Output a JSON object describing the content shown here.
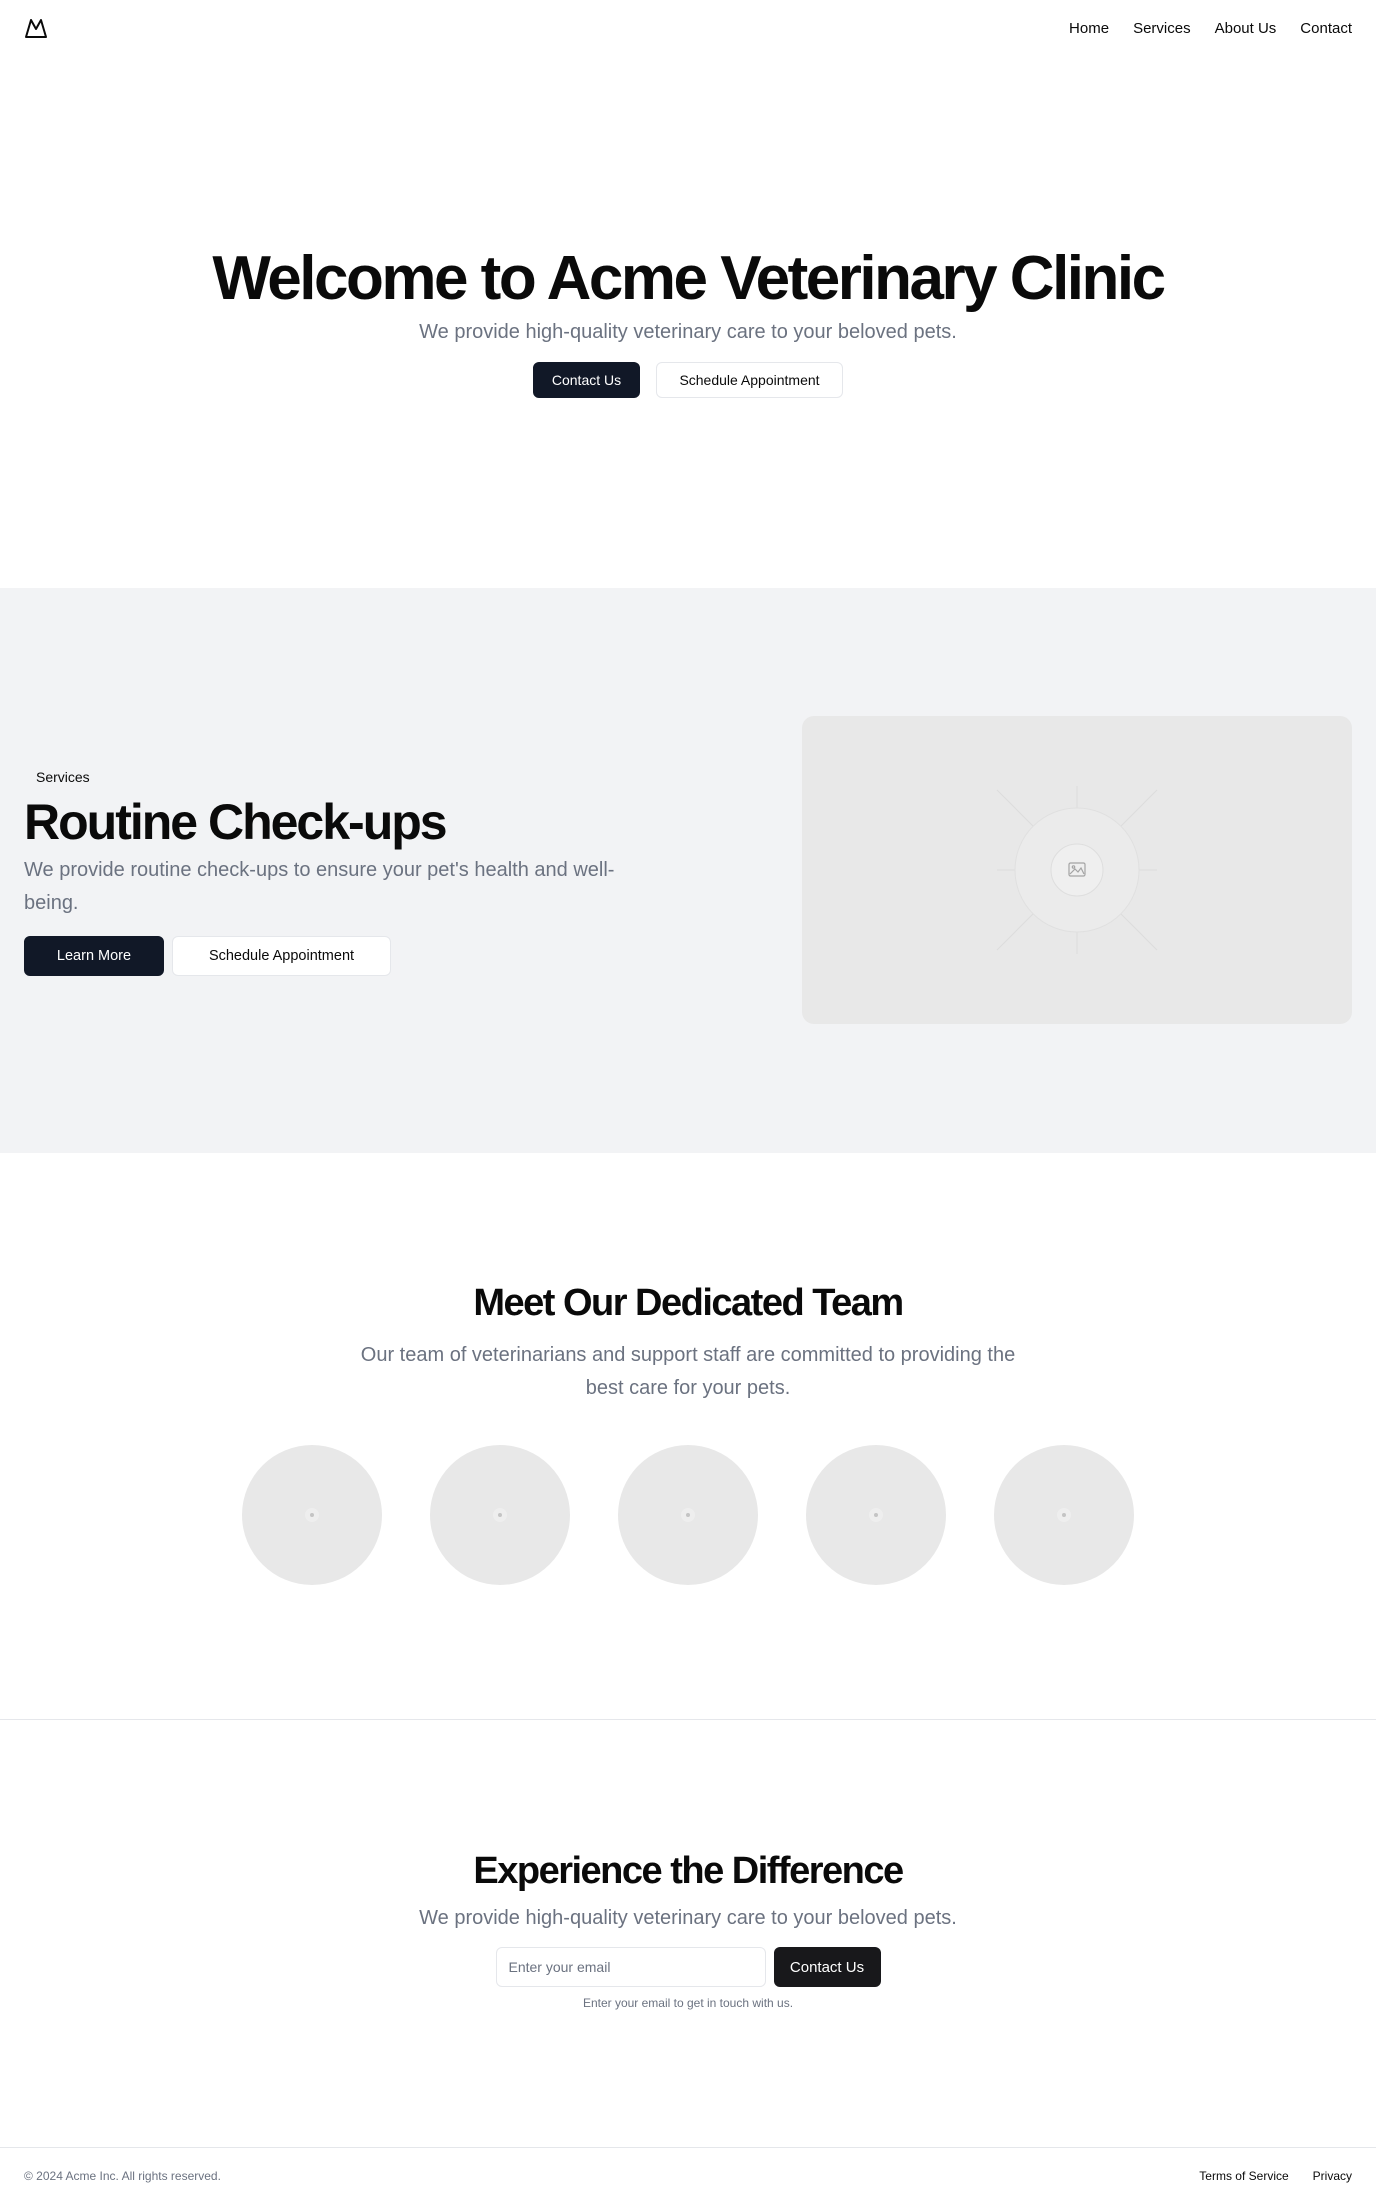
{
  "header": {
    "logo_icon": "mountain-icon",
    "nav": [
      {
        "label": "Home"
      },
      {
        "label": "Services"
      },
      {
        "label": "About Us"
      },
      {
        "label": "Contact"
      }
    ]
  },
  "hero": {
    "title": "Welcome to Acme Veterinary Clinic",
    "subtitle": "We provide high-quality veterinary care to your beloved pets.",
    "primary_button": "Contact Us",
    "secondary_button": "Schedule Appointment"
  },
  "services": {
    "badge": "Services",
    "title": "Routine Check-ups",
    "description": "We provide routine check-ups to ensure your pet's health and well-being.",
    "primary_button": "Learn More",
    "secondary_button": "Schedule Appointment",
    "image_icon": "image-placeholder-icon"
  },
  "team": {
    "title": "Meet Our Dedicated Team",
    "description": "Our team of veterinarians and support staff are committed to providing the best care for your pets.",
    "member_count_shown": 5,
    "avatar_icon": "avatar-placeholder-icon"
  },
  "cta": {
    "title": "Experience the Difference",
    "subtitle": "We provide high-quality veterinary care to your beloved pets.",
    "email_placeholder": "Enter your email",
    "submit_button": "Contact Us",
    "hint": "Enter your email to get in touch with us."
  },
  "footer": {
    "copyright": "© 2024 Acme Inc. All rights reserved.",
    "links": [
      {
        "label": "Terms of Service"
      },
      {
        "label": "Privacy"
      }
    ]
  },
  "colors": {
    "primary_button": "#111827",
    "muted_text": "#6b7280",
    "section_bg": "#f2f3f5",
    "placeholder_bg": "#e8e8e8",
    "border": "#e5e7eb"
  }
}
